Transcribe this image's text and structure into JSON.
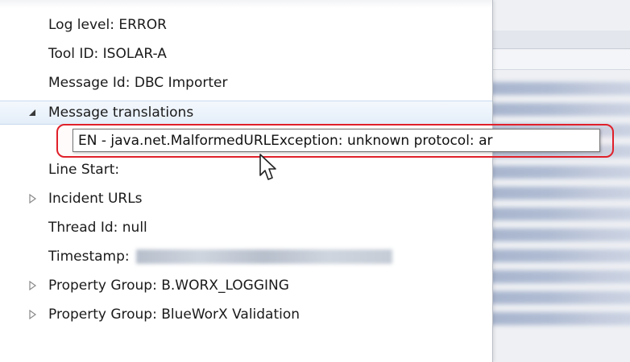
{
  "tree": {
    "items": [
      {
        "label": "Log level: ERROR",
        "expander": "none"
      },
      {
        "label": "Tool ID: ISOLAR-A",
        "expander": "none"
      },
      {
        "label": "Message Id: DBC Importer",
        "expander": "none"
      },
      {
        "label": "Message translations",
        "expander": "expanded",
        "selected": true
      },
      {
        "label": "",
        "expander": "none"
      },
      {
        "label": "Line Start:",
        "expander": "none"
      },
      {
        "label": "Incident URLs",
        "expander": "collapsed"
      },
      {
        "label": "Thread Id: null",
        "expander": "none"
      },
      {
        "label": "Timestamp:",
        "expander": "none",
        "value_blurred": true
      },
      {
        "label": "Property Group: B.WORX_LOGGING",
        "expander": "collapsed"
      },
      {
        "label": "Property Group: BlueWorX Validation",
        "expander": "collapsed"
      }
    ]
  },
  "tooltip": {
    "text": "EN - java.net.MalformedURLException: unknown protocol: ar"
  },
  "colors": {
    "highlight": "#e0202a",
    "selection": "#e4eef9",
    "text": "#1a1a1a"
  }
}
